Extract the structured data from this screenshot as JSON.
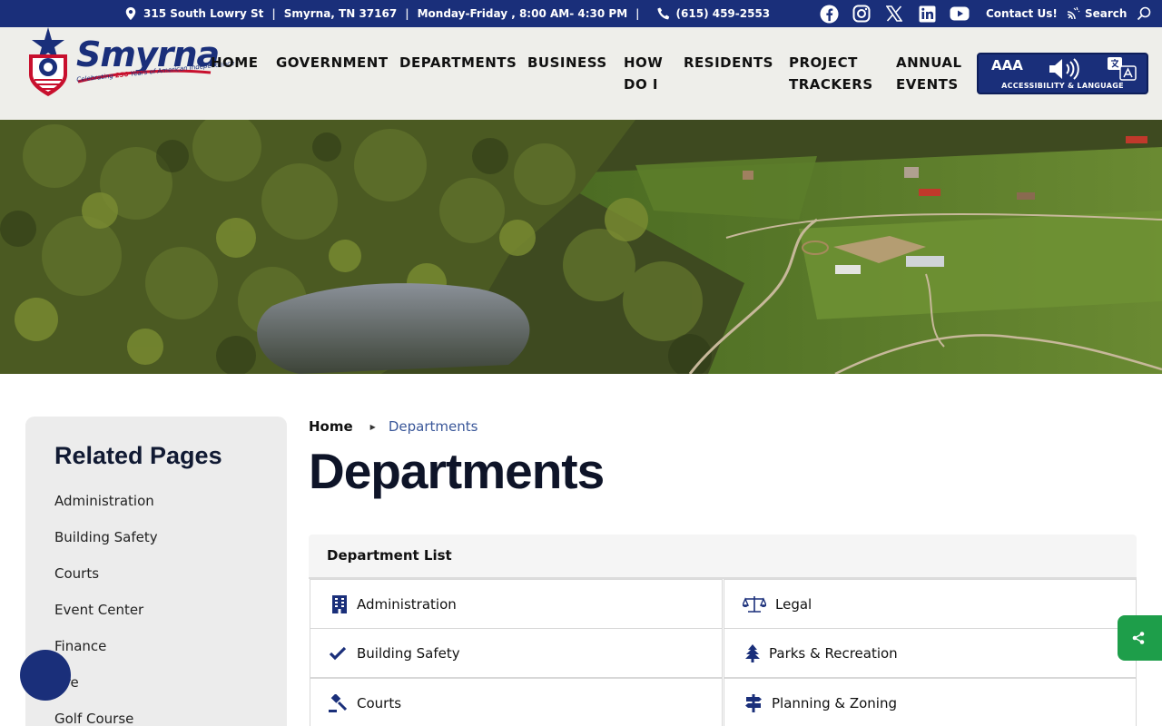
{
  "topbar": {
    "address": "315 South Lowry St",
    "city": "Smyrna, TN 37167",
    "hours": "Monday-Friday , 8:00 AM- 4:30 PM",
    "separator": "|",
    "phone": "(615) 459-2553",
    "contact_label": "Contact Us!",
    "search_label": "Search",
    "socials": [
      "facebook-icon",
      "instagram-icon",
      "x-icon",
      "linkedin-icon",
      "youtube-icon"
    ]
  },
  "logo": {
    "wordmark": "Smyrna",
    "tagline_pre": "Celebrating ",
    "tagline_num": "250",
    "tagline_post": " Years of American Independence"
  },
  "nav": {
    "home": "HOME",
    "government": "GOVERNMENT",
    "departments": "DEPARTMENTS",
    "business": "BUSINESS",
    "how_1": "HOW",
    "how_2": "DO I",
    "residents": "RESIDENTS",
    "project_1": "PROJECT",
    "project_2": "TRACKERS",
    "annual_1": "ANNUAL",
    "annual_2": "EVENTS"
  },
  "accessibility": {
    "label": "ACCESSIBILITY & LANGUAGE",
    "text_size": "AAA"
  },
  "sidebar": {
    "title": "Related Pages",
    "items": [
      "Administration",
      "Building Safety",
      "Courts",
      "Event Center",
      "Finance",
      "Fire",
      "Golf Course"
    ]
  },
  "breadcrumb": {
    "home": "Home",
    "current": "Departments"
  },
  "page": {
    "title": "Departments"
  },
  "departments": {
    "header": "Department List",
    "left": [
      "Administration",
      "Building Safety",
      "Courts"
    ],
    "right": [
      "Legal",
      "Parks & Recreation",
      "Planning & Zoning"
    ]
  },
  "colors": {
    "brand_navy": "#1a2f7a",
    "brand_red": "#c8102e",
    "share_green": "#1e9e4a",
    "crumb_blue": "#3a5799"
  }
}
